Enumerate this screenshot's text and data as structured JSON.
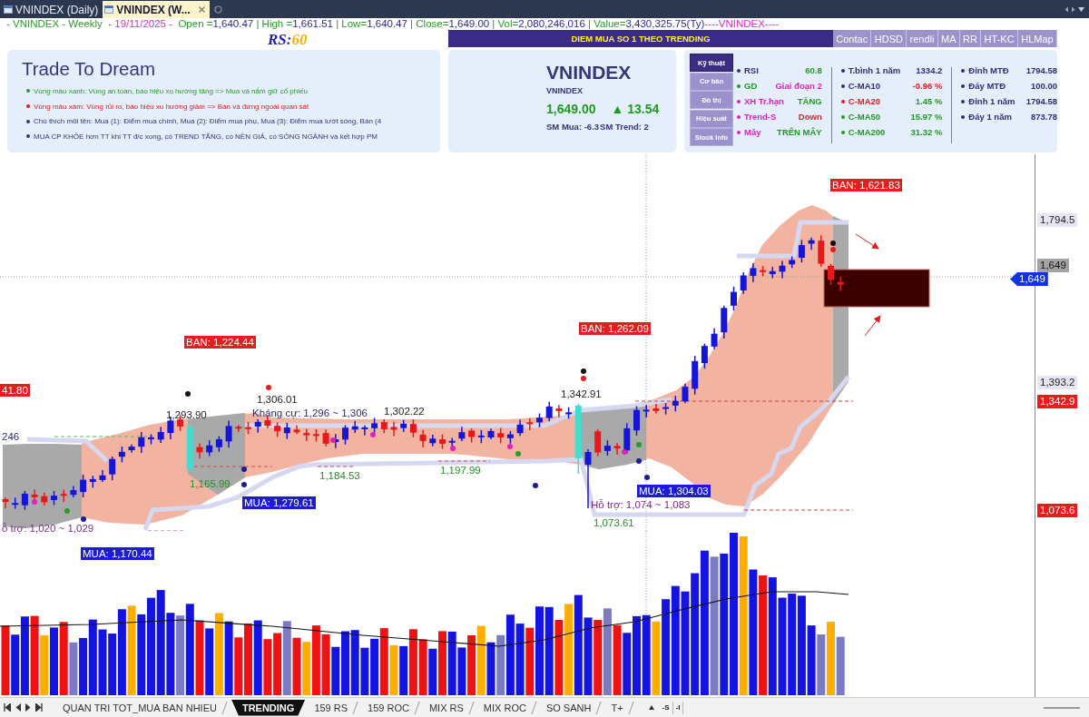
{
  "document_tabs": [
    {
      "label": "VNINDEX (Daily)",
      "selected": false
    },
    {
      "label": "VNINDEX (W...",
      "selected": true
    }
  ],
  "quote_line": [
    {
      "kind": "title",
      "text": "- VNINDEX - Weekly  -"
    },
    {
      "kind": "date",
      "text": " 19/11/2025 -"
    },
    {
      "kind": "label",
      "text": "  Open ="
    },
    {
      "kind": "value",
      "text": "1,640.47"
    },
    {
      "kind": "label",
      "text": " | High ="
    },
    {
      "kind": "value",
      "text": "1,661.51"
    },
    {
      "kind": "label",
      "text": " | Low="
    },
    {
      "kind": "value",
      "text": "1,640.47"
    },
    {
      "kind": "label",
      "text": " | Close="
    },
    {
      "kind": "value",
      "text": "1,649.00"
    },
    {
      "kind": "label",
      "text": " | Vol="
    },
    {
      "kind": "value",
      "text": "2,080,246,016"
    },
    {
      "kind": "label",
      "text": " | Value="
    },
    {
      "kind": "value",
      "text": "3,430,325.75(Ty)"
    },
    {
      "kind": "symbol",
      "text": "----VNINDEX----"
    }
  ],
  "rs": {
    "label": "RS:",
    "value": "60"
  },
  "intro_panel": {
    "title": "Trade To Dream",
    "notes": [
      {
        "text": "Vùng màu xanh: Vùng an toàn, báo hiệu xu hướng tăng => Mua và nắm giữ cổ phiếu",
        "color": "#2a9a2a"
      },
      {
        "text": "Vùng màu xám: Vùng rủi ro, báo hiệu xu hướng giảm => Bán và đứng ngoài quan sát",
        "color": "#e01c1c"
      },
      {
        "text": "Chú thích mũi tên: Mua (1): Điểm mua chính, Mua (2): Điểm mua phụ, Mua (3): Điểm mua lướt sóng, Bán (4",
        "color": "#33337a"
      },
      {
        "text": "MUA CP KHỎE hơn TT khi TT đ/c xong, có TREND TĂNG, có NỀN GIÁ, có SÓNG NGÀNH và kết hợp PM",
        "color": "#33337a"
      }
    ]
  },
  "banner": "DIEM MUA SO 1 THEO TRENDING",
  "toolbar_buttons": [
    "Contac",
    "HDSD",
    "rendli",
    "MA",
    "RR",
    "HT-KC",
    "HLMap"
  ],
  "quote_panel": {
    "symbol": "VNINDEX",
    "name": "VNINDEX",
    "price": "1,649.00",
    "change": "▲ 13.54",
    "sm_buy": "SM Mua: -6.3",
    "sm_trend": "SM Trend: 2"
  },
  "side_tabs": [
    {
      "label": "Kỹ thuật",
      "selected": true
    },
    {
      "label": "Cơ bản",
      "selected": false
    },
    {
      "label": "Đồ thị",
      "selected": false
    },
    {
      "label": "Hiệu suất",
      "selected": false
    },
    {
      "label": "Stock Info",
      "selected": false
    }
  ],
  "indicator_columns": [
    {
      "rows": [
        {
          "color": "#2d2d7a",
          "label": {
            "text": "RSI",
            "color": "#2d2d7a"
          },
          "value": {
            "text": "60.8",
            "color": "#1f9a1f"
          }
        },
        {
          "color": "#1f9a1f",
          "label": {
            "text": "GD",
            "color": "#1f9a1f"
          },
          "value": {
            "text": "Giai đoạn 2",
            "color": "#e020c0"
          }
        },
        {
          "color": "#e020c0",
          "label": {
            "text": "XH Tr.hạn",
            "color": "#e020c0"
          },
          "value": {
            "text": "TĂNG",
            "color": "#1f9a1f"
          }
        },
        {
          "color": "#e020c0",
          "label": {
            "text": "Trend-S",
            "color": "#e020c0"
          },
          "value": {
            "text": "Down",
            "color": "#e41c1c"
          }
        },
        {
          "color": "#e020c0",
          "label": {
            "text": "Mây",
            "color": "#e020c0"
          },
          "value": {
            "text": "TRÊN MÂY",
            "color": "#1f9a1f"
          }
        }
      ]
    },
    {
      "rows": [
        {
          "color": "#2d2d7a",
          "label": {
            "text": "T.bình 1 năm",
            "color": "#2d2d7a"
          },
          "value": {
            "text": "1334.2",
            "color": "#2d2d7a"
          }
        },
        {
          "color": "#2d2d7a",
          "label": {
            "text": "C-MA10",
            "color": "#2d2d7a"
          },
          "value": {
            "text": "-0.96 %",
            "color": "#e41c1c"
          }
        },
        {
          "color": "#e41c1c",
          "label": {
            "text": "C-MA20",
            "color": "#e41c1c"
          },
          "value": {
            "text": "1.45 %",
            "color": "#1f9a1f"
          }
        },
        {
          "color": "#1f9a1f",
          "label": {
            "text": "C-MA50",
            "color": "#1f9a1f"
          },
          "value": {
            "text": "15.97 %",
            "color": "#1f9a1f"
          }
        },
        {
          "color": "#1f9a1f",
          "label": {
            "text": "C-MA200",
            "color": "#1f9a1f"
          },
          "value": {
            "text": "31.32 %",
            "color": "#1f9a1f"
          }
        }
      ]
    },
    {
      "rows": [
        {
          "color": "#2d2d7a",
          "label": {
            "text": "Đỉnh MTĐ",
            "color": "#2d2d7a"
          },
          "value": {
            "text": "1794.58",
            "color": "#2d2d7a"
          }
        },
        {
          "color": "#2d2d7a",
          "label": {
            "text": "Đáy MTĐ",
            "color": "#2d2d7a"
          },
          "value": {
            "text": "100.00",
            "color": "#2d2d7a"
          }
        },
        {
          "color": "#2d2d7a",
          "label": {
            "text": "Đỉnh 1 năm",
            "color": "#2d2d7a"
          },
          "value": {
            "text": "1794.58",
            "color": "#2d2d7a"
          }
        },
        {
          "color": "#2d2d7a",
          "label": {
            "text": "Đáy 1 năm",
            "color": "#2d2d7a"
          },
          "value": {
            "text": "873.78",
            "color": "#2d2d7a"
          }
        }
      ]
    }
  ],
  "chart_labels": [
    {
      "kind": "sell",
      "text": "BAN: 1,621.83"
    },
    {
      "kind": "sell",
      "text": "BAN: 1,262.09"
    },
    {
      "kind": "sell",
      "text": "BAN: 1,224.44"
    },
    {
      "kind": "sell",
      "text": "41.80"
    },
    {
      "kind": "price",
      "text": "1,342.91"
    },
    {
      "kind": "price",
      "text": "1,306.01"
    },
    {
      "kind": "price",
      "text": "1,302.22"
    },
    {
      "kind": "price",
      "text": "1,293.90"
    },
    {
      "kind": "resistance",
      "text": "Kháng cự: 1,296 ~ 1,306"
    },
    {
      "kind": "level",
      "text": "246"
    },
    {
      "kind": "low",
      "text": "1,197.99"
    },
    {
      "kind": "low",
      "text": "1,184.53"
    },
    {
      "kind": "low",
      "text": "1,165.99"
    },
    {
      "kind": "buy",
      "text": "MUA: 1,304.03"
    },
    {
      "kind": "buy",
      "text": "MUA: 1,279.61"
    },
    {
      "kind": "support",
      "text": "Hỗ trợ: 1,074 ~ 1,083"
    },
    {
      "kind": "low",
      "text": "1,073.61"
    },
    {
      "kind": "support",
      "text": "ỗ trợ: 1,020 ~ 1,029"
    },
    {
      "kind": "buy",
      "text": "MUA: 1,170.44"
    }
  ],
  "axis_tags": [
    {
      "kind": "plain",
      "text": "1,794.5"
    },
    {
      "kind": "last",
      "text": "1,649"
    },
    {
      "kind": "current",
      "text": "1,649"
    },
    {
      "kind": "plain",
      "text": "1,393.2"
    },
    {
      "kind": "alert",
      "text": "1,342.9"
    },
    {
      "kind": "alert",
      "text": "1,073.6"
    }
  ],
  "sheet_tabs": [
    {
      "label": "QUAN TRI TOT_MUA BAN NHIEU",
      "selected": false
    },
    {
      "label": "TRENDING",
      "selected": true
    },
    {
      "label": "159 RS",
      "selected": false
    },
    {
      "label": "159 ROC",
      "selected": false
    },
    {
      "label": "MIX RS",
      "selected": false
    },
    {
      "label": "MIX ROC",
      "selected": false
    },
    {
      "label": "SO SANH",
      "selected": false
    },
    {
      "label": "T+",
      "selected": false
    }
  ],
  "sheet_tools": [
    "-S",
    "-I"
  ]
}
